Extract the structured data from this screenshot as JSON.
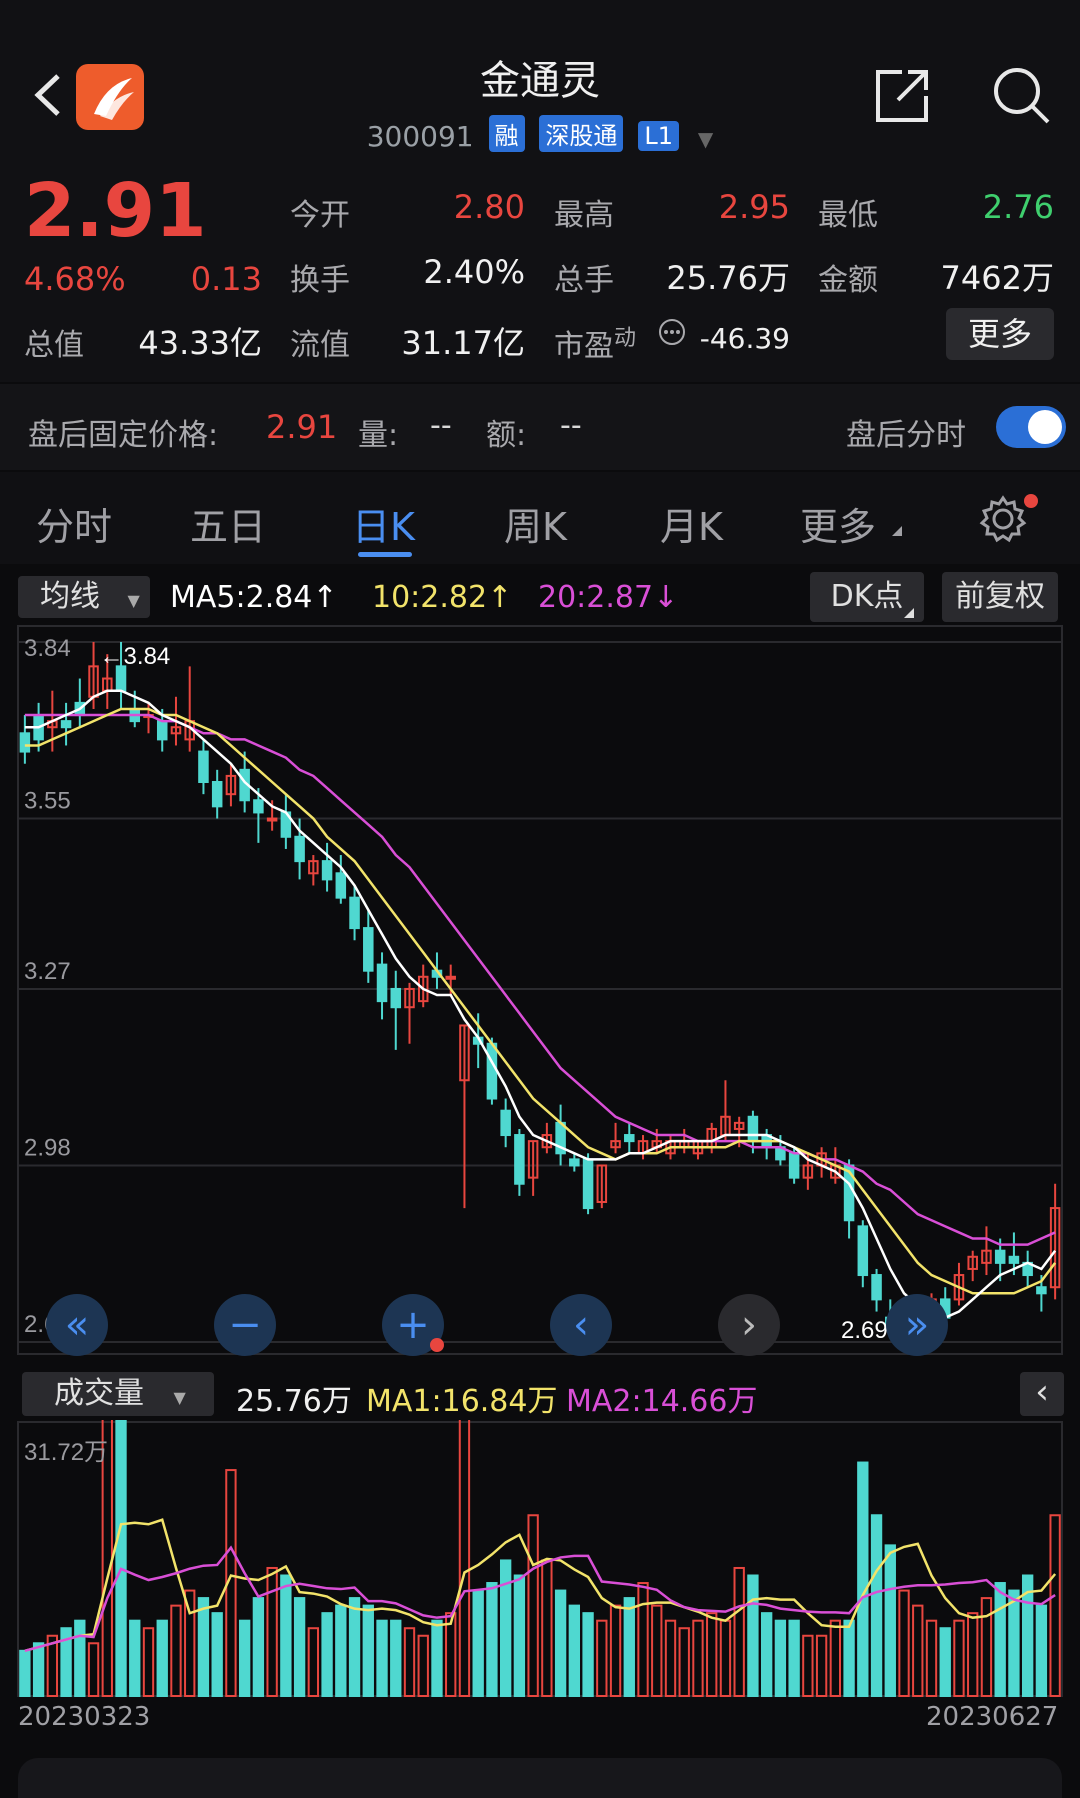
{
  "header": {
    "title": "金通灵",
    "code": "300091",
    "badges": [
      "融",
      "深股通",
      "L1"
    ]
  },
  "quote": {
    "price": "2.91",
    "change_pct": "4.68%",
    "change": "0.13",
    "open_label": "今开",
    "open": "2.80",
    "high_label": "最高",
    "high": "2.95",
    "low_label": "最低",
    "low": "2.76",
    "turnover_label": "换手",
    "turnover": "2.40%",
    "vol_label": "总手",
    "vol": "25.76万",
    "amount_label": "金额",
    "amount": "7462万",
    "mcap_label": "总值",
    "mcap": "43.33亿",
    "float_label": "流值",
    "float_cap": "31.17亿",
    "pe_label": "市盈",
    "pe_sup": "动",
    "pe": "-46.39",
    "more_label": "更多"
  },
  "after_hours": {
    "label": "盘后固定价格:",
    "price": "2.91",
    "vol_label": "量:",
    "vol": "--",
    "amt_label": "额:",
    "amt": "--",
    "toggle_label": "盘后分时",
    "toggle_on": true
  },
  "tabs": [
    "分时",
    "五日",
    "日K",
    "周K",
    "月K",
    "更多"
  ],
  "active_tab": "日K",
  "kline": {
    "ma_select": "均线",
    "ma5": "MA5:2.84↑",
    "ma10": "10:2.82↑",
    "ma20": "20:2.87↓",
    "dk_label": "DK点",
    "fq_label": "前复权",
    "price_ticks": [
      "3.84",
      "3.55",
      "3.27",
      "2.98",
      "2.69"
    ],
    "max_marker": "←3.84",
    "min_marker": "2.69→",
    "colors": {
      "up": "#e8463f",
      "down": "#4fd8d0",
      "ma5": "#ffffff",
      "ma10": "#f2e36a",
      "ma20": "#d94fd6"
    }
  },
  "volume": {
    "select": "成交量",
    "vol": "25.76万",
    "ma1": "MA1:16.84万",
    "ma2": "MA2:14.66万",
    "top_label": "31.72万",
    "start_date": "20230323",
    "end_date": "20230627"
  },
  "chart_data": {
    "type": "candlestick",
    "ylim": [
      2.69,
      3.84
    ],
    "candles": [
      [
        3.69,
        3.72,
        3.66,
        3.64
      ],
      [
        3.72,
        3.74,
        3.68,
        3.66
      ],
      [
        3.7,
        3.76,
        3.71,
        3.66
      ],
      [
        3.71,
        3.74,
        3.7,
        3.67
      ],
      [
        3.74,
        3.78,
        3.72,
        3.7
      ],
      [
        3.75,
        3.84,
        3.8,
        3.73
      ],
      [
        3.76,
        3.82,
        3.78,
        3.73
      ],
      [
        3.8,
        3.84,
        3.76,
        3.73
      ],
      [
        3.73,
        3.76,
        3.71,
        3.7
      ],
      [
        3.72,
        3.74,
        3.72,
        3.69
      ],
      [
        3.71,
        3.73,
        3.68,
        3.66
      ],
      [
        3.69,
        3.75,
        3.7,
        3.67
      ],
      [
        3.68,
        3.8,
        3.71,
        3.66
      ],
      [
        3.66,
        3.68,
        3.61,
        3.59
      ],
      [
        3.61,
        3.63,
        3.57,
        3.55
      ],
      [
        3.59,
        3.64,
        3.62,
        3.57
      ],
      [
        3.63,
        3.66,
        3.58,
        3.56
      ],
      [
        3.58,
        3.6,
        3.56,
        3.51
      ],
      [
        3.55,
        3.58,
        3.55,
        3.53
      ],
      [
        3.56,
        3.59,
        3.52,
        3.5
      ],
      [
        3.52,
        3.55,
        3.48,
        3.45
      ],
      [
        3.46,
        3.49,
        3.48,
        3.44
      ],
      [
        3.48,
        3.51,
        3.45,
        3.43
      ],
      [
        3.46,
        3.49,
        3.42,
        3.41
      ],
      [
        3.42,
        3.44,
        3.37,
        3.35
      ],
      [
        3.37,
        3.4,
        3.3,
        3.28
      ],
      [
        3.31,
        3.33,
        3.25,
        3.22
      ],
      [
        3.27,
        3.3,
        3.24,
        3.17
      ],
      [
        3.24,
        3.28,
        3.27,
        3.18
      ],
      [
        3.25,
        3.31,
        3.29,
        3.24
      ],
      [
        3.3,
        3.33,
        3.29,
        3.27
      ],
      [
        3.29,
        3.31,
        3.29,
        3.26
      ],
      [
        3.12,
        3.21,
        3.21,
        2.91
      ],
      [
        3.19,
        3.23,
        3.18,
        3.14
      ],
      [
        3.18,
        3.19,
        3.09,
        3.08
      ],
      [
        3.07,
        3.09,
        3.03,
        3.01
      ],
      [
        3.03,
        3.04,
        2.95,
        2.93
      ],
      [
        2.96,
        3.02,
        3.02,
        2.93
      ],
      [
        3.01,
        3.05,
        3.03,
        3.0
      ],
      [
        3.05,
        3.08,
        3.0,
        2.98
      ],
      [
        2.99,
        3.0,
        2.98,
        2.97
      ],
      [
        2.99,
        3.0,
        2.91,
        2.9
      ],
      [
        2.92,
        2.98,
        2.98,
        2.91
      ],
      [
        3.01,
        3.05,
        3.02,
        3.0
      ],
      [
        3.03,
        3.05,
        3.02,
        3.0
      ],
      [
        3.0,
        3.03,
        3.02,
        2.99
      ],
      [
        3.01,
        3.04,
        3.02,
        3.0
      ],
      [
        3.0,
        3.03,
        3.02,
        2.99
      ],
      [
        3.01,
        3.04,
        3.02,
        3.0
      ],
      [
        3.0,
        3.02,
        3.02,
        2.99
      ],
      [
        3.01,
        3.05,
        3.04,
        3.0
      ],
      [
        3.03,
        3.12,
        3.06,
        3.02
      ],
      [
        3.04,
        3.06,
        3.05,
        3.01
      ],
      [
        3.06,
        3.07,
        3.02,
        3.0
      ],
      [
        3.03,
        3.04,
        3.01,
        2.99
      ],
      [
        3.01,
        3.03,
        2.99,
        2.98
      ],
      [
        3.0,
        3.01,
        2.96,
        2.95
      ],
      [
        2.96,
        3.0,
        2.98,
        2.94
      ],
      [
        2.98,
        3.01,
        3.0,
        2.96
      ],
      [
        2.96,
        3.01,
        2.98,
        2.95
      ],
      [
        2.98,
        2.99,
        2.89,
        2.86
      ],
      [
        2.88,
        2.89,
        2.8,
        2.78
      ],
      [
        2.8,
        2.81,
        2.76,
        2.74
      ],
      [
        2.73,
        2.76,
        2.71,
        2.7
      ],
      [
        2.72,
        2.76,
        2.74,
        2.7
      ],
      [
        2.73,
        2.75,
        2.73,
        2.69
      ],
      [
        2.73,
        2.77,
        2.76,
        2.72
      ],
      [
        2.76,
        2.78,
        2.73,
        2.71
      ],
      [
        2.76,
        2.82,
        2.8,
        2.75
      ],
      [
        2.81,
        2.84,
        2.83,
        2.79
      ],
      [
        2.82,
        2.88,
        2.84,
        2.8
      ],
      [
        2.84,
        2.86,
        2.82,
        2.79
      ],
      [
        2.83,
        2.87,
        2.82,
        2.8
      ],
      [
        2.82,
        2.84,
        2.8,
        2.78
      ],
      [
        2.78,
        2.8,
        2.77,
        2.74
      ],
      [
        2.78,
        2.95,
        2.91,
        2.76
      ]
    ],
    "ma5": [
      3.7,
      3.7,
      3.71,
      3.72,
      3.73,
      3.75,
      3.76,
      3.76,
      3.75,
      3.74,
      3.72,
      3.71,
      3.7,
      3.68,
      3.66,
      3.64,
      3.61,
      3.59,
      3.57,
      3.56,
      3.53,
      3.51,
      3.49,
      3.47,
      3.44,
      3.4,
      3.36,
      3.32,
      3.29,
      3.27,
      3.26,
      3.26,
      3.22,
      3.19,
      3.15,
      3.11,
      3.06,
      3.03,
      3.02,
      3.01,
      3.0,
      2.99,
      2.99,
      2.99,
      3.0,
      3.0,
      3.01,
      3.02,
      3.02,
      3.02,
      3.02,
      3.03,
      3.03,
      3.03,
      3.03,
      3.02,
      3.01,
      2.99,
      2.98,
      2.97,
      2.95,
      2.91,
      2.86,
      2.81,
      2.77,
      2.75,
      2.73,
      2.73,
      2.74,
      2.76,
      2.78,
      2.8,
      2.81,
      2.82,
      2.81,
      2.84
    ],
    "ma10": [
      3.67,
      3.67,
      3.68,
      3.69,
      3.7,
      3.71,
      3.72,
      3.73,
      3.73,
      3.73,
      3.72,
      3.72,
      3.71,
      3.7,
      3.69,
      3.67,
      3.65,
      3.63,
      3.61,
      3.59,
      3.57,
      3.55,
      3.52,
      3.5,
      3.48,
      3.45,
      3.42,
      3.39,
      3.36,
      3.33,
      3.3,
      3.27,
      3.24,
      3.21,
      3.18,
      3.15,
      3.12,
      3.09,
      3.07,
      3.05,
      3.03,
      3.01,
      3.0,
      2.99,
      3.0,
      3.0,
      3.0,
      3.01,
      3.01,
      3.01,
      3.01,
      3.01,
      3.02,
      3.02,
      3.02,
      3.02,
      3.01,
      3.0,
      2.99,
      2.98,
      2.97,
      2.94,
      2.91,
      2.88,
      2.85,
      2.82,
      2.8,
      2.79,
      2.78,
      2.77,
      2.77,
      2.77,
      2.77,
      2.78,
      2.79,
      2.82
    ],
    "ma20": [
      3.72,
      3.72,
      3.72,
      3.72,
      3.72,
      3.72,
      3.72,
      3.72,
      3.72,
      3.72,
      3.71,
      3.71,
      3.7,
      3.69,
      3.69,
      3.68,
      3.68,
      3.67,
      3.66,
      3.65,
      3.63,
      3.62,
      3.6,
      3.58,
      3.56,
      3.54,
      3.52,
      3.49,
      3.47,
      3.44,
      3.41,
      3.38,
      3.35,
      3.32,
      3.29,
      3.26,
      3.23,
      3.2,
      3.17,
      3.14,
      3.12,
      3.1,
      3.08,
      3.06,
      3.05,
      3.04,
      3.03,
      3.03,
      3.03,
      3.02,
      3.02,
      3.02,
      3.02,
      3.01,
      3.01,
      3.01,
      3.0,
      3.0,
      2.99,
      2.99,
      2.98,
      2.97,
      2.95,
      2.94,
      2.92,
      2.9,
      2.89,
      2.88,
      2.87,
      2.86,
      2.86,
      2.85,
      2.85,
      2.85,
      2.86,
      2.87
    ],
    "volumes": [
      6,
      7,
      8,
      9,
      10,
      7,
      44,
      44,
      10,
      9,
      10,
      12,
      14,
      13,
      11,
      30,
      10,
      13,
      17,
      16,
      13,
      9,
      11,
      12,
      13,
      12,
      10,
      10,
      9,
      8,
      10,
      11,
      44,
      14,
      15,
      18,
      16,
      24,
      18,
      14,
      12,
      11,
      10,
      12,
      13,
      15,
      12,
      10,
      9,
      10,
      11,
      10,
      17,
      16,
      11,
      10,
      10,
      8,
      8,
      10,
      10,
      31,
      24,
      20,
      14,
      12,
      10,
      9,
      10,
      11,
      13,
      15,
      14,
      16,
      12,
      24
    ],
    "vol_max": 31.72
  }
}
